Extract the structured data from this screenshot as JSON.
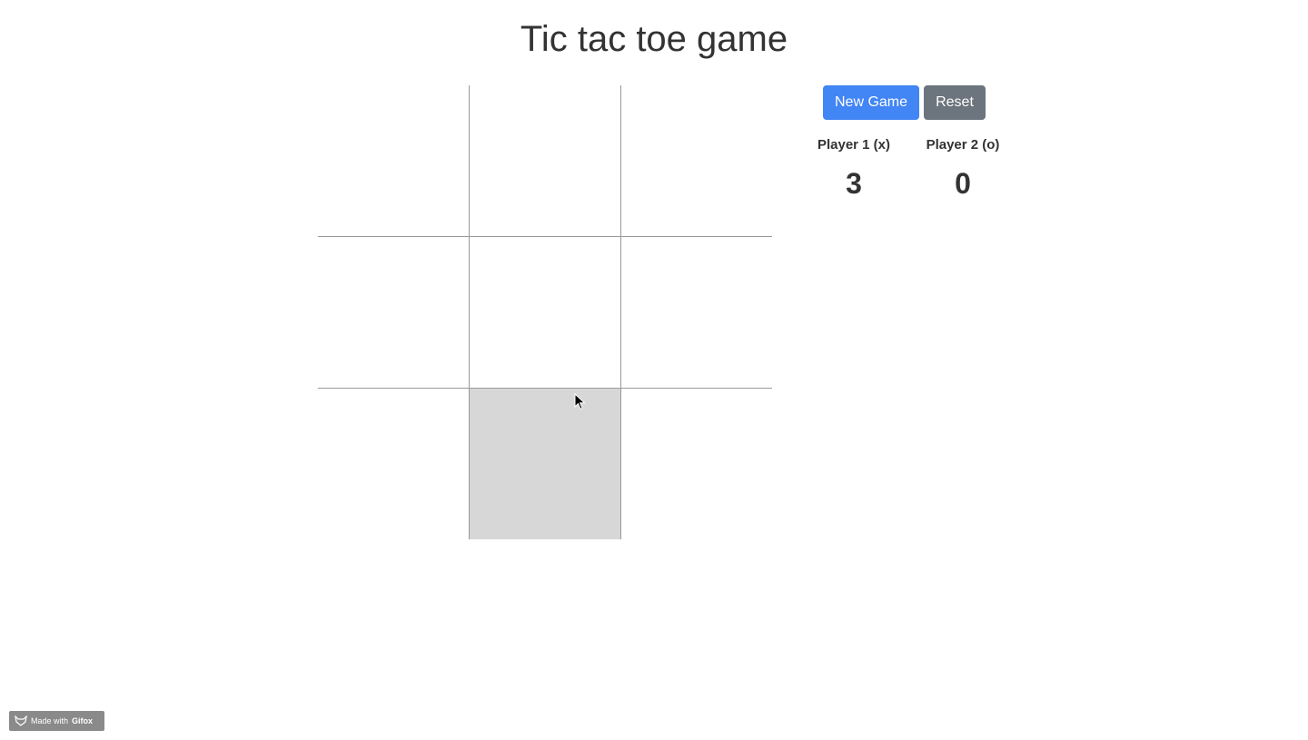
{
  "page": {
    "title": "Tic tac toe game"
  },
  "board": {
    "cells": [
      "",
      "",
      "",
      "",
      "",
      "",
      "",
      "",
      ""
    ],
    "hovered_cell": 7
  },
  "controls": {
    "new_game_label": "New Game",
    "reset_label": "Reset"
  },
  "scoreboard": {
    "player1": {
      "label": "Player 1 (x)",
      "score": "3"
    },
    "player2": {
      "label": "Player 2 (o)",
      "score": "0"
    }
  },
  "watermark": {
    "prefix": "Made with",
    "brand": "Gifox"
  },
  "colors": {
    "primary_button": "#4285f4",
    "secondary_button": "#6c757d",
    "hover_cell": "#d7d7d7",
    "grid_line": "#9a9a9a",
    "text": "#333333"
  },
  "icons": {
    "cursor": "arrow-cursor-icon",
    "watermark_logo": "fox-logo-icon"
  }
}
